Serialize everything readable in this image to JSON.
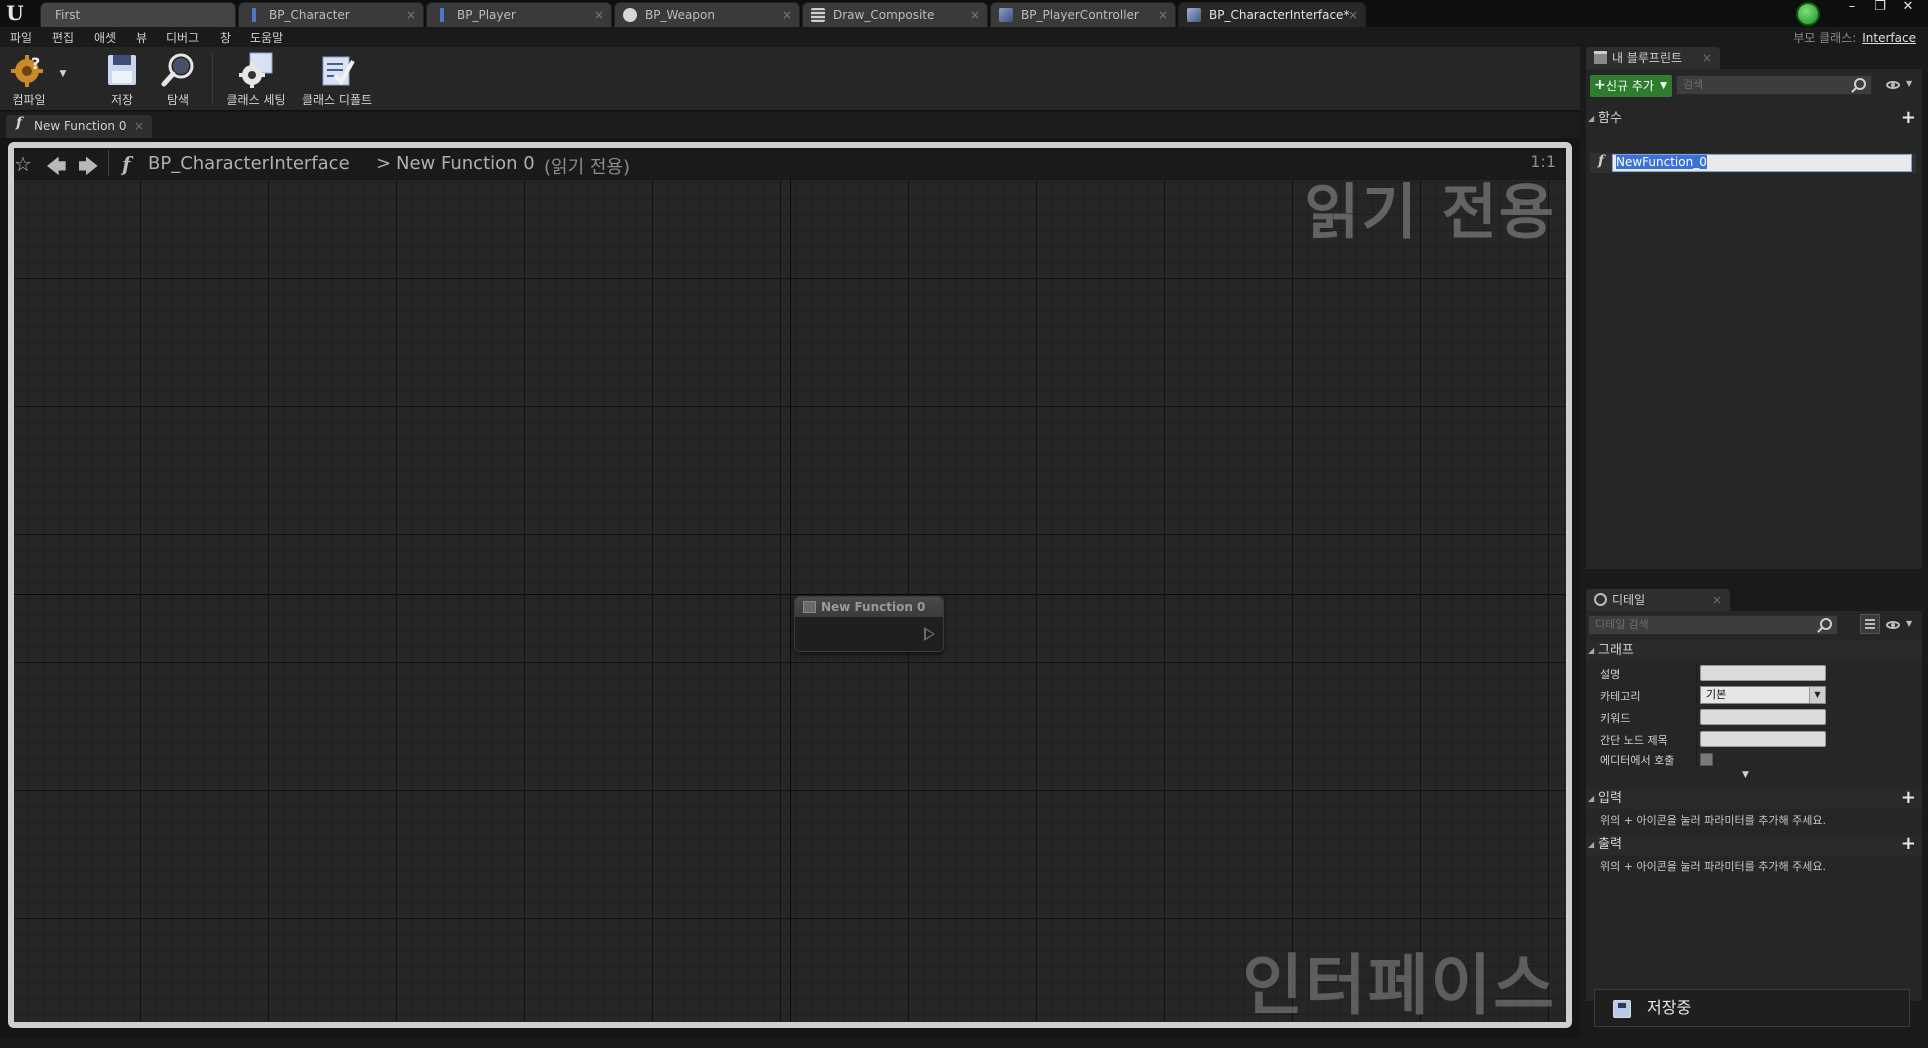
{
  "window": {
    "tabs": [
      {
        "label": "First"
      },
      {
        "label": "BP_Character"
      },
      {
        "label": "BP_Player"
      },
      {
        "label": "BP_Weapon"
      },
      {
        "label": "Draw_Composite"
      },
      {
        "label": "BP_PlayerController"
      },
      {
        "label": "BP_CharacterInterface*"
      }
    ],
    "tab_close": "×",
    "minimize": "–",
    "maximize": "❐",
    "close": "✕"
  },
  "menu": {
    "items": [
      "파일",
      "편집",
      "애셋",
      "뷰",
      "디버그",
      "창",
      "도움말"
    ],
    "parent_class_label": "부모 클래스:",
    "parent_class_value": "Interface"
  },
  "toolbar": {
    "compile": "컴파일",
    "save": "저장",
    "browse": "탐색",
    "class_settings": "클래스 세팅",
    "class_defaults": "클래스 디폴트"
  },
  "graph": {
    "tab_label": "New Function 0",
    "breadcrumb_blueprint": "BP_CharacterInterface",
    "breadcrumb_separator": ">",
    "breadcrumb_function": "New Function 0",
    "read_only_tag": "(읽기 전용)",
    "zoom": "1:1",
    "watermark_readonly": "읽기 전용",
    "watermark_type": "인터페이스",
    "node_title": "New Function 0"
  },
  "my_blueprint": {
    "tab_label": "내 블루프린트",
    "add_new": "신규 추가",
    "search_placeholder": "검색",
    "functions_header": "함수",
    "function_name": "NewFunction_0"
  },
  "details": {
    "tab_label": "디테일",
    "search_placeholder": "디테일 검색",
    "graph_header": "그래프",
    "props": {
      "description": "설명",
      "category": "카테고리",
      "category_value": "기본",
      "keywords": "키워드",
      "compact_title": "간단 노드 제목",
      "call_in_editor": "에디터에서 호출"
    },
    "inputs_header": "입력",
    "outputs_header": "출력",
    "inputs_hint": "위의 + 아이콘을 눌러 파라미터를 추가해 주세요.",
    "outputs_hint": "위의 + 아이콘을 눌러 파라미터를 추가해 주세요."
  },
  "notification": {
    "saving": "저장중"
  },
  "colors": {
    "add_new_green": "#2e7d2e",
    "selection_blue": "#3a72d8",
    "graph_border": "#cfcfcf"
  }
}
